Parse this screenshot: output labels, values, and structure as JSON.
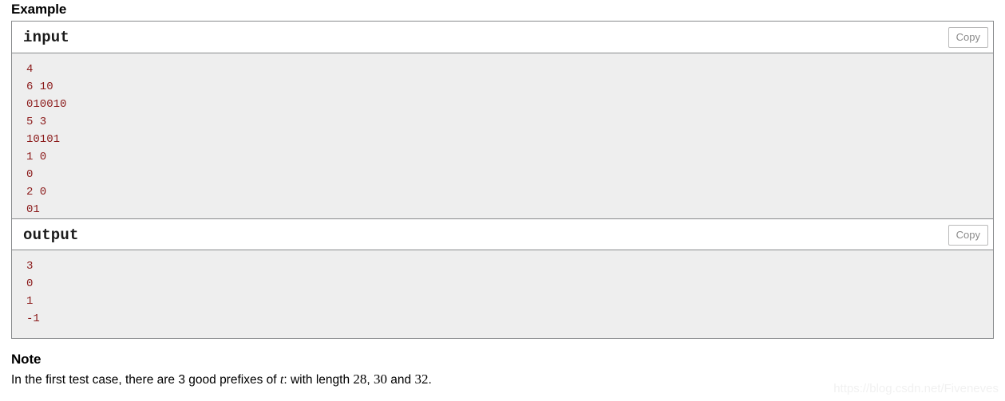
{
  "example": {
    "heading": "Example",
    "blocks": [
      {
        "title": "input",
        "copy_label": "Copy",
        "content": "4\n6 10\n010010\n5 3\n10101\n1 0\n0\n2 0\n01"
      },
      {
        "title": "output",
        "copy_label": "Copy",
        "content": "3\n0\n1\n-1"
      }
    ]
  },
  "note": {
    "heading": "Note",
    "text_part1": "In the first test case, there are 3 good prefixes of ",
    "math_var": "t",
    "text_part2": ": with length ",
    "num1": "28",
    "sep1": ", ",
    "num2": "30",
    "sep2": " and ",
    "num3": "32",
    "period": "."
  },
  "watermark": {
    "text": "https://blog.csdn.net/Fiveneves"
  },
  "colors": {
    "sample_text": "#8b1a1a",
    "sample_bg": "#eeeeee",
    "border": "#888a8c",
    "copy_text": "#8a8a8a",
    "watermark": "#f1f1f1"
  }
}
